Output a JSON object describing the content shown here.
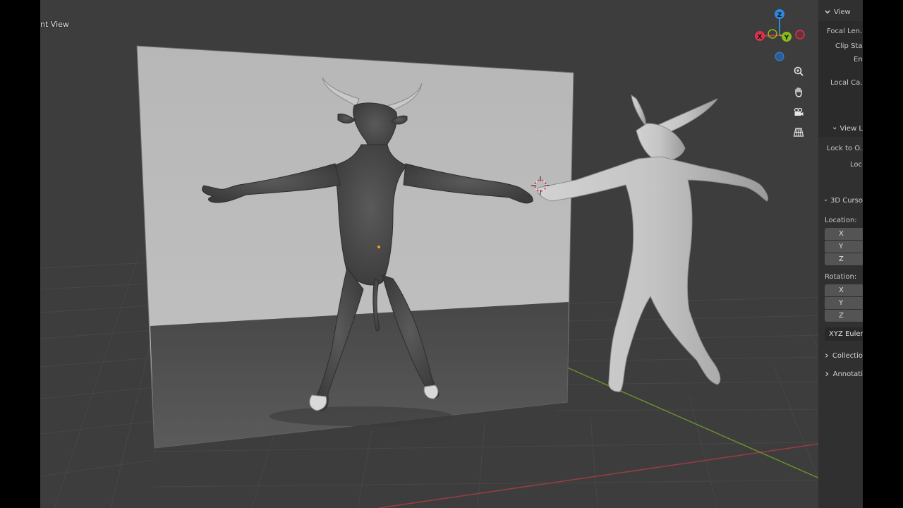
{
  "viewport": {
    "title": "nt View"
  },
  "gizmo": {
    "z": "Z",
    "y": "Y",
    "x": "X",
    "colors": {
      "x": "#d8334a",
      "y": "#8bbd1a",
      "z": "#2d8ae0"
    }
  },
  "nav_buttons": [
    {
      "icon": "zoom-icon"
    },
    {
      "icon": "hand-pan-icon"
    },
    {
      "icon": "camera-icon"
    },
    {
      "icon": "grid-perspective-icon"
    }
  ],
  "npanel": {
    "view_section": "View",
    "focal_length": "Focal Len...",
    "clip_start": "Clip Star",
    "clip_end": "En",
    "local_camera": "Local Ca...",
    "view_lock_section": "View L",
    "lock_to_object": "Lock to O...",
    "lock": "Loc",
    "cursor_section": "3D Curso",
    "location_label": "Location:",
    "location_fields": [
      "X",
      "Y",
      "Z"
    ],
    "rotation_label": "Rotation:",
    "rotation_fields": [
      "X",
      "Y",
      "Z"
    ],
    "rotation_mode": "XYZ Euler",
    "collections_section": "Collectio",
    "annotations_section": "Annotati"
  },
  "scene": {
    "objects": [
      "background-plane",
      "textured-minotaur",
      "clay-minotaur",
      "3d-cursor"
    ]
  }
}
